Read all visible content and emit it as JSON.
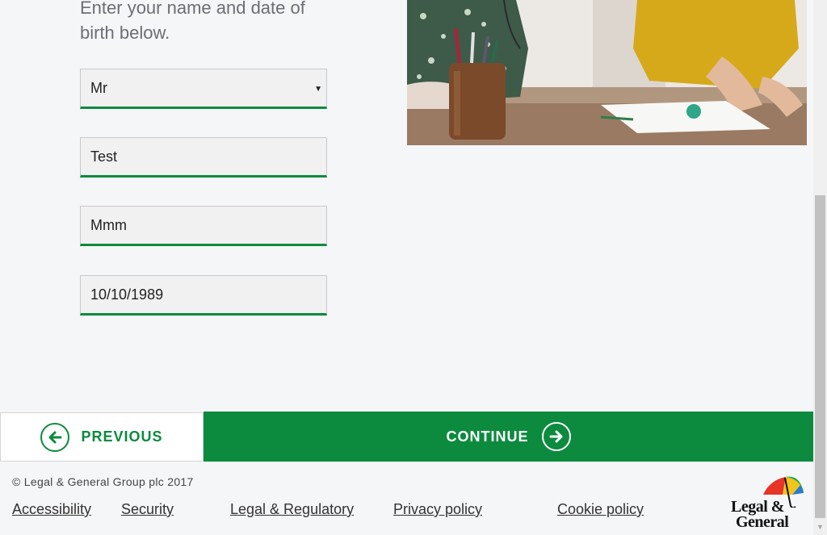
{
  "intro_text": "Enter your name and date of birth below.",
  "form": {
    "title_select": "Mr",
    "first_name": "Test",
    "last_name": "Mmm",
    "dob": "10/10/1989"
  },
  "nav": {
    "previous_label": "PREVIOUS",
    "continue_label": "CONTINUE"
  },
  "footer": {
    "copyright": "© Legal & General Group plc 2017",
    "links": [
      "Accessibility",
      "Security",
      "Legal & Regulatory",
      "Privacy policy",
      "Cookie policy"
    ],
    "logo_line1": "Legal &",
    "logo_line2": "General"
  },
  "colors": {
    "brand_green": "#0c8a3e"
  }
}
